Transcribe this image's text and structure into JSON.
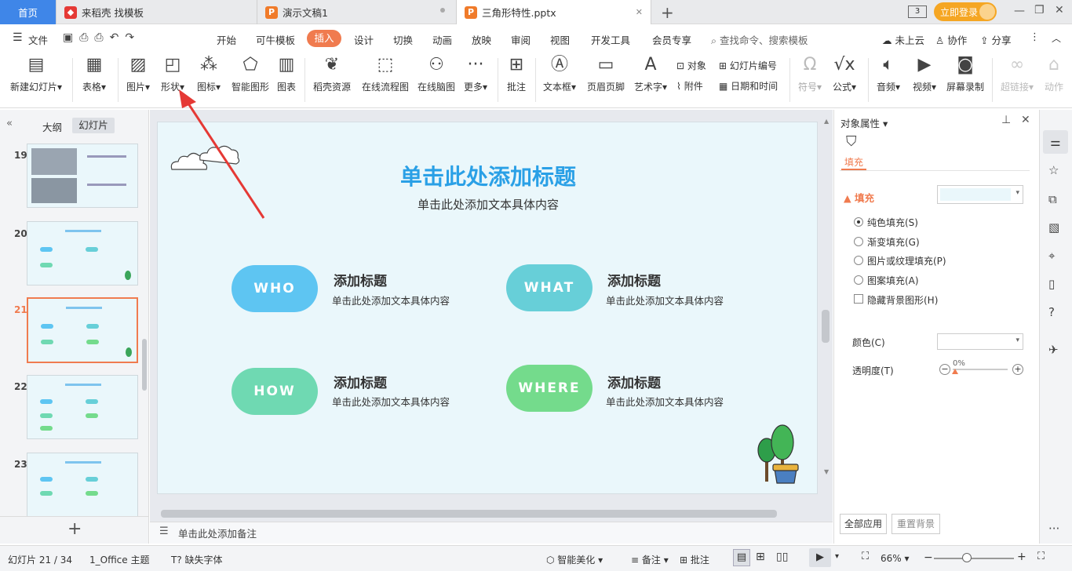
{
  "tabs": {
    "home": "首页",
    "tab1": "来稻壳 找模板",
    "tab2": "演示文稿1",
    "tab3": "三角形特性.pptx",
    "add": "+",
    "login": "立即登录"
  },
  "menu": {
    "file": "文件",
    "items": [
      "开始",
      "可牛模板",
      "插入",
      "设计",
      "切换",
      "动画",
      "放映",
      "审阅",
      "视图",
      "开发工具",
      "会员专享"
    ],
    "search": "查找命令、搜索模板",
    "cloud": "未上云",
    "collab": "协作",
    "share": "分享"
  },
  "ribbon": {
    "new_slide": "新建幻灯片",
    "table": "表格",
    "picture": "图片",
    "shape": "形状",
    "icon": "图标",
    "smartart": "智能图形",
    "chart": "图表",
    "daoke": "稻壳资源",
    "flow": "在线流程图",
    "mindmap": "在线脑图",
    "more": "更多",
    "comment": "批注",
    "textbox": "文本框",
    "header_footer": "页眉页脚",
    "wordart": "艺术字",
    "object": "对象",
    "slide_no": "幻灯片编号",
    "attach": "附件",
    "datetime": "日期和时间",
    "symbol": "符号",
    "formula": "公式",
    "audio": "音频",
    "video": "视频",
    "screenrec": "屏幕录制",
    "hyperlink": "超链接",
    "action": "动作"
  },
  "left": {
    "outline": "大纲",
    "slides": "幻灯片",
    "nums": [
      "19",
      "20",
      "21",
      "22",
      "23"
    ],
    "add": "+"
  },
  "slide": {
    "title": "单击此处添加标题",
    "subtitle": "单击此处添加文本具体内容",
    "items": [
      {
        "pill": "WHO",
        "title": "添加标题",
        "desc": "单击此处添加文本具体内容",
        "color": "#5ec5f2"
      },
      {
        "pill": "WHAT",
        "title": "添加标题",
        "desc": "单击此处添加文本具体内容",
        "color": "#67cfd8"
      },
      {
        "pill": "HOW",
        "title": "添加标题",
        "desc": "单击此处添加文本具体内容",
        "color": "#6fd9b2"
      },
      {
        "pill": "WHERE",
        "title": "添加标题",
        "desc": "单击此处添加文本具体内容",
        "color": "#74db8c"
      }
    ]
  },
  "notes": "单击此处添加备注",
  "right": {
    "title": "对象属性",
    "tab": "填充",
    "section": "填充",
    "options": [
      "纯色填充(S)",
      "渐变填充(G)",
      "图片或纹理填充(P)",
      "图案填充(A)"
    ],
    "hide_bg": "隐藏背景图形(H)",
    "color_label": "颜色(C)",
    "transparency_label": "透明度(T)",
    "transparency_value": "0%",
    "apply_all": "全部应用",
    "reset_bg": "重置背景"
  },
  "status": {
    "slide_count": "幻灯片 21 / 34",
    "theme": "1_Office 主题",
    "missing_font": "缺失字体",
    "beautify": "智能美化",
    "notes": "备注",
    "comment": "批注",
    "zoom": "66%"
  },
  "colors": {
    "accent": "#f07b4f",
    "blue_title": "#2aa0e6",
    "arrow": "#e53935"
  }
}
